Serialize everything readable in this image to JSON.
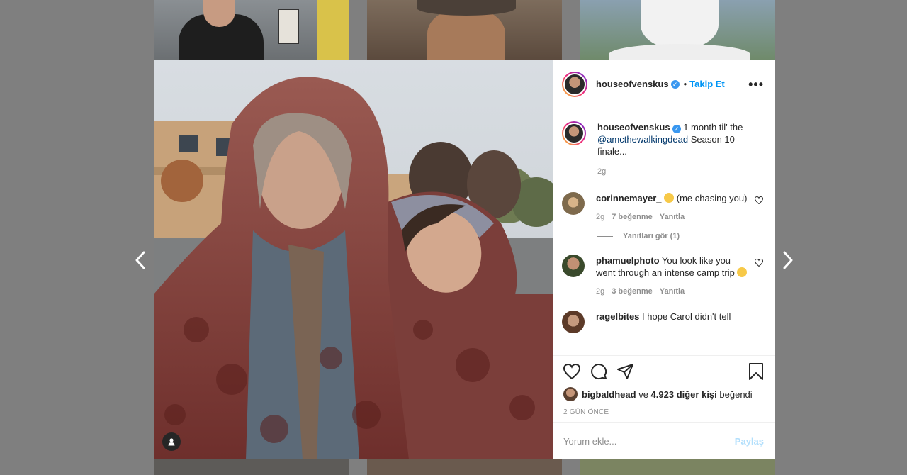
{
  "post": {
    "author": "houseofvenskus",
    "follow_label": "Takip Et",
    "separator": "•",
    "more_label": "•••"
  },
  "caption": {
    "username": "houseofvenskus",
    "text_before": "1 month til' the",
    "mention": "@amcthewalkingdead",
    "text_after": "Season 10 finale...",
    "time": "2g"
  },
  "comments": [
    {
      "username": "corinnemayer_",
      "text": "(me chasing you)",
      "time": "2g",
      "likes": "7 beğenme",
      "reply_label": "Yanıtla",
      "view_replies": "Yanıtları gör (1)"
    },
    {
      "username": "phamuelphoto",
      "text": "You look like you went through an intense camp trip",
      "time": "2g",
      "likes": "3 beğenme",
      "reply_label": "Yanıtla"
    },
    {
      "username": "ragelbites",
      "text": "I hope Carol didn't tell"
    }
  ],
  "likes": {
    "user": "bigbaldhead",
    "connector": "ve",
    "others": "4.923 diğer kişi",
    "suffix": "beğendi"
  },
  "timestamp": "2 GÜN ÖNCE",
  "comment_input": {
    "placeholder": "Yorum ekle...",
    "share_label": "Paylaş"
  },
  "icons": [
    "chevron-left-icon",
    "chevron-right-icon",
    "heart-icon",
    "comment-icon",
    "share-icon",
    "bookmark-icon",
    "user-tag-icon",
    "verified-icon"
  ],
  "colors": {
    "link": "#00376b",
    "follow": "#0095f6",
    "share_disabled": "#b2dffc",
    "verified": "#3897f0"
  }
}
